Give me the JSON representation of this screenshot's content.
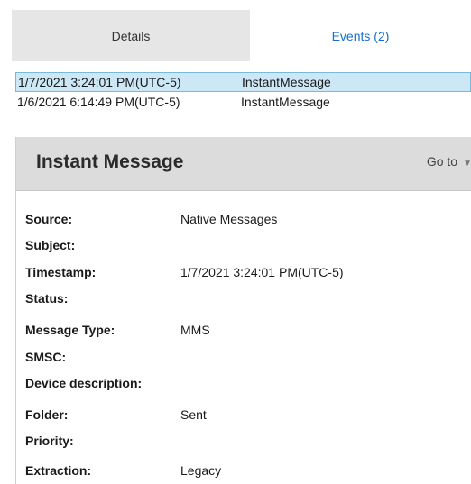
{
  "tabs": [
    {
      "label": "Details"
    },
    {
      "label": "Events (2)"
    }
  ],
  "events": [
    {
      "timestamp": "1/7/2021 3:24:01 PM(UTC-5)",
      "type": "InstantMessage",
      "selected": true
    },
    {
      "timestamp": "1/6/2021 6:14:49 PM(UTC-5)",
      "type": "InstantMessage",
      "selected": false
    }
  ],
  "panel": {
    "title": "Instant Message",
    "goto_label": "Go to"
  },
  "fields": [
    {
      "label": "Source:",
      "value": "Native Messages"
    },
    {
      "label": "Subject:",
      "value": ""
    },
    {
      "label": "Timestamp:",
      "value": "1/7/2021 3:24:01 PM(UTC-5)"
    },
    {
      "label": "Status:",
      "value": ""
    },
    {
      "label": "Message Type:",
      "value": "MMS"
    },
    {
      "label": "SMSC:",
      "value": ""
    },
    {
      "label": "Device description:",
      "value": ""
    },
    {
      "label": "Folder:",
      "value": "Sent"
    },
    {
      "label": "Priority:",
      "value": ""
    },
    {
      "label": "Extraction:",
      "value": "Legacy"
    }
  ],
  "colors": {
    "selected_row": "#cce8f6",
    "active_tab_text": "#1a6fc9",
    "inactive_tab_bg": "#e6e6e6",
    "panel_header_bg": "#dcdcdc"
  }
}
